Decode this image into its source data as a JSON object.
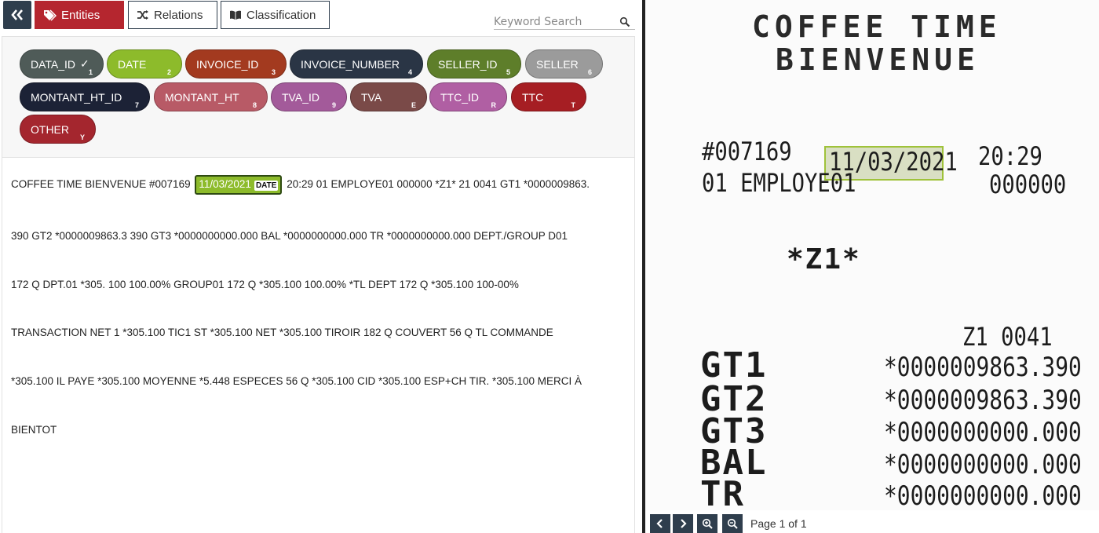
{
  "toolbar": {
    "tabs": [
      {
        "label": "Entities",
        "active": true
      },
      {
        "label": "Relations",
        "active": false
      },
      {
        "label": "Classification",
        "active": false
      }
    ],
    "search_placeholder": "Keyword Search"
  },
  "labels": [
    {
      "name": "DATA_ID",
      "key": "1",
      "color": "#4f5b58",
      "checked": true
    },
    {
      "name": "DATE",
      "key": "2",
      "color": "#8dbb2b"
    },
    {
      "name": "INVOICE_ID",
      "key": "3",
      "color": "#a33a1f"
    },
    {
      "name": "INVOICE_NUMBER",
      "key": "4",
      "color": "#2a3545"
    },
    {
      "name": "SELLER_ID",
      "key": "5",
      "color": "#5e7e2a"
    },
    {
      "name": "SELLER",
      "key": "6",
      "color": "#9b9b9b"
    },
    {
      "name": "MONTANT_HT_ID",
      "key": "7",
      "color": "#1c2236"
    },
    {
      "name": "MONTANT_HT",
      "key": "8",
      "color": "#b85a66"
    },
    {
      "name": "TVA_ID",
      "key": "9",
      "color": "#a35a9a"
    },
    {
      "name": "TVA",
      "key": "E",
      "color": "#7a4a48"
    },
    {
      "name": "TTC_ID",
      "key": "R",
      "color": "#b05fa3"
    },
    {
      "name": "TTC",
      "key": "T",
      "color": "#a61e23"
    },
    {
      "name": "OTHER",
      "key": "Y",
      "color": "#a4262e"
    }
  ],
  "document_text": {
    "line1_before": "COFFEE TIME BIENVENUE #007169",
    "line1_entity": "11/03/2021",
    "line1_entity_tag": "DATE",
    "line1_after": "20:29 01 EMPLOYE01 000000 *Z1* 21 0041 GT1 *0000009863.",
    "lines": [
      "390 GT2 *0000009863.3 390 GT3 *0000000000.000 BAL *0000000000.000 TR *0000000000.000 DEPT./GROUP D01",
      "172 Q DPT.01 *305. 100 100.00% GROUP01 172 Q *305.100 100.00% *TL DEPT 172 Q *305.100 100-00%",
      "TRANSACTION NET 1 *305.100 TIC1 ST *305.100 NET *305.100 TIROIR 182 Q COUVERT 56 Q TL COMMANDE",
      "*305.100 IL PAYE *305.100 MOYENNE *5.448 ESPECES 56 Q *305.100 CID *305.100 ESP+CH TIR. *305.100 MERCI À",
      "BIENTOT"
    ]
  },
  "receipt": {
    "header1": "COFFEE TIME",
    "header2": "BIENVENUE",
    "number": "#007169",
    "date": "11/03/2021",
    "time": "20:29",
    "employee": "01 EMPLOYE01",
    "employee_code": "000000",
    "z": "*Z1*",
    "z_line": "Z1  0041",
    "rows": [
      {
        "label": "GT1",
        "value": "*0000009863.390"
      },
      {
        "label": "GT2",
        "value": "*0000009863.390"
      },
      {
        "label": "GT3",
        "value": "*0000000000.000"
      },
      {
        "label": "BAL",
        "value": "*0000000000.000"
      },
      {
        "label": "TR",
        "value": "*0000000000.000"
      }
    ]
  },
  "pager": {
    "label": "Page 1 of 1"
  }
}
